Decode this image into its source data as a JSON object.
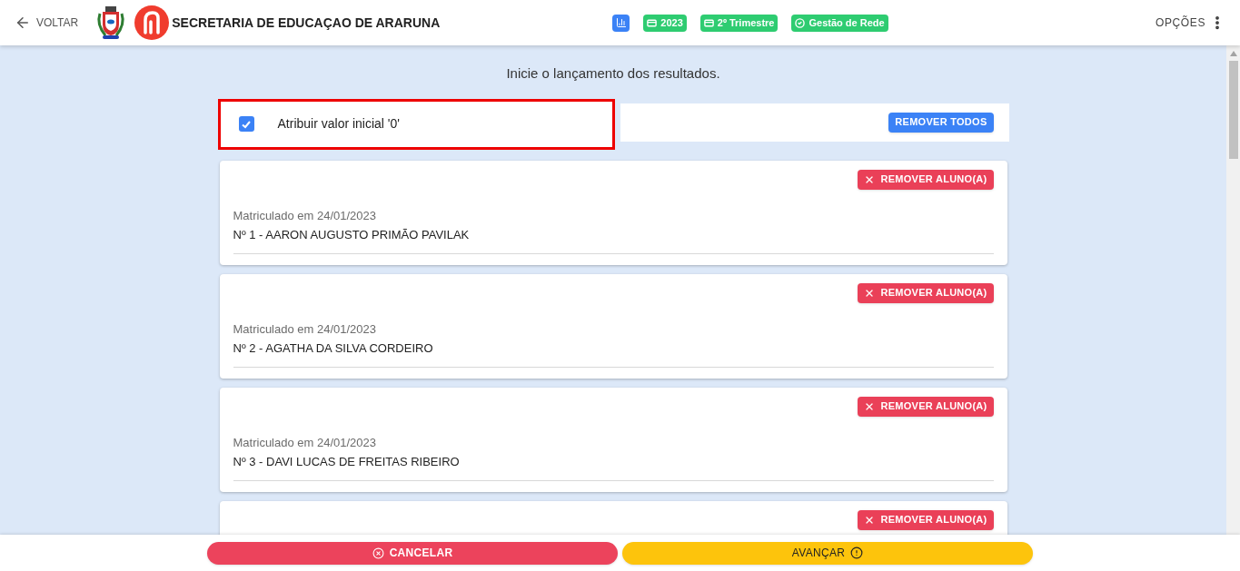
{
  "header": {
    "back_label": "VOLTAR",
    "title": "SECRETARIA DE EDUCAÇAO DE ARARUNA",
    "chips": [
      {
        "kind": "icon"
      },
      {
        "kind": "calendar",
        "label": "2023"
      },
      {
        "kind": "calendar",
        "label": "2º Trimestre"
      },
      {
        "kind": "check",
        "label": "Gestão de Rede"
      }
    ],
    "options_label": "OPÇÕES"
  },
  "intro": "Inicie o lançamento dos resultados.",
  "initial_value": {
    "label": "Atribuir valor inicial '0'",
    "checked": true,
    "highlighted": true
  },
  "remove_all_label": "REMOVER TODOS",
  "students": [
    {
      "enrolled": "Matriculado em 24/01/2023",
      "name": "Nº 1 - AARON AUGUSTO PRIMÃO PAVILAK",
      "remove_label": "REMOVER ALUNO(A)"
    },
    {
      "enrolled": "Matriculado em 24/01/2023",
      "name": "Nº 2 - AGATHA DA SILVA CORDEIRO",
      "remove_label": "REMOVER ALUNO(A)"
    },
    {
      "enrolled": "Matriculado em 24/01/2023",
      "name": "Nº 3 - DAVI LUCAS DE FREITAS RIBEIRO",
      "remove_label": "REMOVER ALUNO(A)"
    },
    {
      "remove_label": "REMOVER ALUNO(A)"
    }
  ],
  "footer": {
    "cancel_label": "CANCELAR",
    "next_label": "AVANÇAR"
  }
}
